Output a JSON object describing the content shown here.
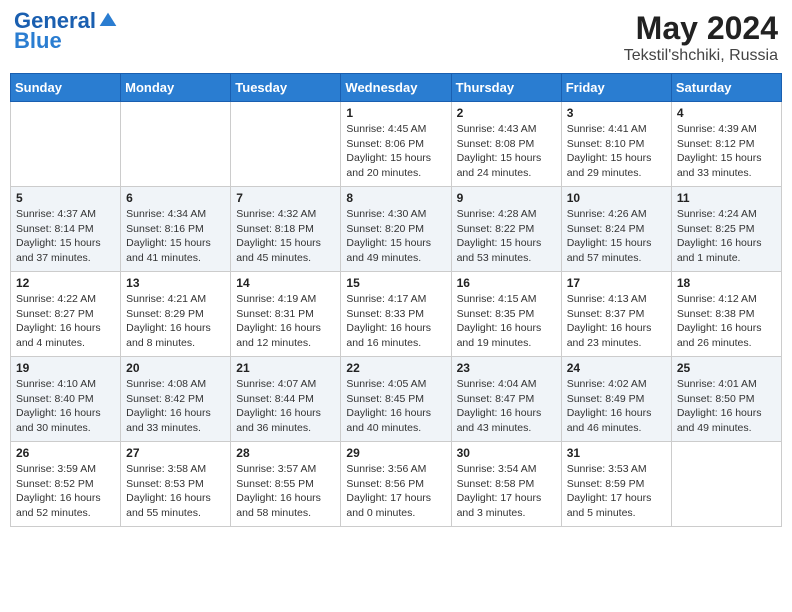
{
  "header": {
    "logo_line1": "General",
    "logo_line2": "Blue",
    "month": "May 2024",
    "location": "Tekstil'shchiki, Russia"
  },
  "days_of_week": [
    "Sunday",
    "Monday",
    "Tuesday",
    "Wednesday",
    "Thursday",
    "Friday",
    "Saturday"
  ],
  "weeks": [
    [
      {
        "day": "",
        "info": ""
      },
      {
        "day": "",
        "info": ""
      },
      {
        "day": "",
        "info": ""
      },
      {
        "day": "1",
        "sunrise": "4:45 AM",
        "sunset": "8:06 PM",
        "daylight": "15 hours and 20 minutes."
      },
      {
        "day": "2",
        "sunrise": "4:43 AM",
        "sunset": "8:08 PM",
        "daylight": "15 hours and 24 minutes."
      },
      {
        "day": "3",
        "sunrise": "4:41 AM",
        "sunset": "8:10 PM",
        "daylight": "15 hours and 29 minutes."
      },
      {
        "day": "4",
        "sunrise": "4:39 AM",
        "sunset": "8:12 PM",
        "daylight": "15 hours and 33 minutes."
      }
    ],
    [
      {
        "day": "5",
        "sunrise": "4:37 AM",
        "sunset": "8:14 PM",
        "daylight": "15 hours and 37 minutes."
      },
      {
        "day": "6",
        "sunrise": "4:34 AM",
        "sunset": "8:16 PM",
        "daylight": "15 hours and 41 minutes."
      },
      {
        "day": "7",
        "sunrise": "4:32 AM",
        "sunset": "8:18 PM",
        "daylight": "15 hours and 45 minutes."
      },
      {
        "day": "8",
        "sunrise": "4:30 AM",
        "sunset": "8:20 PM",
        "daylight": "15 hours and 49 minutes."
      },
      {
        "day": "9",
        "sunrise": "4:28 AM",
        "sunset": "8:22 PM",
        "daylight": "15 hours and 53 minutes."
      },
      {
        "day": "10",
        "sunrise": "4:26 AM",
        "sunset": "8:24 PM",
        "daylight": "15 hours and 57 minutes."
      },
      {
        "day": "11",
        "sunrise": "4:24 AM",
        "sunset": "8:25 PM",
        "daylight": "16 hours and 1 minute."
      }
    ],
    [
      {
        "day": "12",
        "sunrise": "4:22 AM",
        "sunset": "8:27 PM",
        "daylight": "16 hours and 4 minutes."
      },
      {
        "day": "13",
        "sunrise": "4:21 AM",
        "sunset": "8:29 PM",
        "daylight": "16 hours and 8 minutes."
      },
      {
        "day": "14",
        "sunrise": "4:19 AM",
        "sunset": "8:31 PM",
        "daylight": "16 hours and 12 minutes."
      },
      {
        "day": "15",
        "sunrise": "4:17 AM",
        "sunset": "8:33 PM",
        "daylight": "16 hours and 16 minutes."
      },
      {
        "day": "16",
        "sunrise": "4:15 AM",
        "sunset": "8:35 PM",
        "daylight": "16 hours and 19 minutes."
      },
      {
        "day": "17",
        "sunrise": "4:13 AM",
        "sunset": "8:37 PM",
        "daylight": "16 hours and 23 minutes."
      },
      {
        "day": "18",
        "sunrise": "4:12 AM",
        "sunset": "8:38 PM",
        "daylight": "16 hours and 26 minutes."
      }
    ],
    [
      {
        "day": "19",
        "sunrise": "4:10 AM",
        "sunset": "8:40 PM",
        "daylight": "16 hours and 30 minutes."
      },
      {
        "day": "20",
        "sunrise": "4:08 AM",
        "sunset": "8:42 PM",
        "daylight": "16 hours and 33 minutes."
      },
      {
        "day": "21",
        "sunrise": "4:07 AM",
        "sunset": "8:44 PM",
        "daylight": "16 hours and 36 minutes."
      },
      {
        "day": "22",
        "sunrise": "4:05 AM",
        "sunset": "8:45 PM",
        "daylight": "16 hours and 40 minutes."
      },
      {
        "day": "23",
        "sunrise": "4:04 AM",
        "sunset": "8:47 PM",
        "daylight": "16 hours and 43 minutes."
      },
      {
        "day": "24",
        "sunrise": "4:02 AM",
        "sunset": "8:49 PM",
        "daylight": "16 hours and 46 minutes."
      },
      {
        "day": "25",
        "sunrise": "4:01 AM",
        "sunset": "8:50 PM",
        "daylight": "16 hours and 49 minutes."
      }
    ],
    [
      {
        "day": "26",
        "sunrise": "3:59 AM",
        "sunset": "8:52 PM",
        "daylight": "16 hours and 52 minutes."
      },
      {
        "day": "27",
        "sunrise": "3:58 AM",
        "sunset": "8:53 PM",
        "daylight": "16 hours and 55 minutes."
      },
      {
        "day": "28",
        "sunrise": "3:57 AM",
        "sunset": "8:55 PM",
        "daylight": "16 hours and 58 minutes."
      },
      {
        "day": "29",
        "sunrise": "3:56 AM",
        "sunset": "8:56 PM",
        "daylight": "17 hours and 0 minutes."
      },
      {
        "day": "30",
        "sunrise": "3:54 AM",
        "sunset": "8:58 PM",
        "daylight": "17 hours and 3 minutes."
      },
      {
        "day": "31",
        "sunrise": "3:53 AM",
        "sunset": "8:59 PM",
        "daylight": "17 hours and 5 minutes."
      },
      {
        "day": "",
        "info": ""
      }
    ]
  ],
  "labels": {
    "sunrise": "Sunrise:",
    "sunset": "Sunset:",
    "daylight": "Daylight:"
  }
}
